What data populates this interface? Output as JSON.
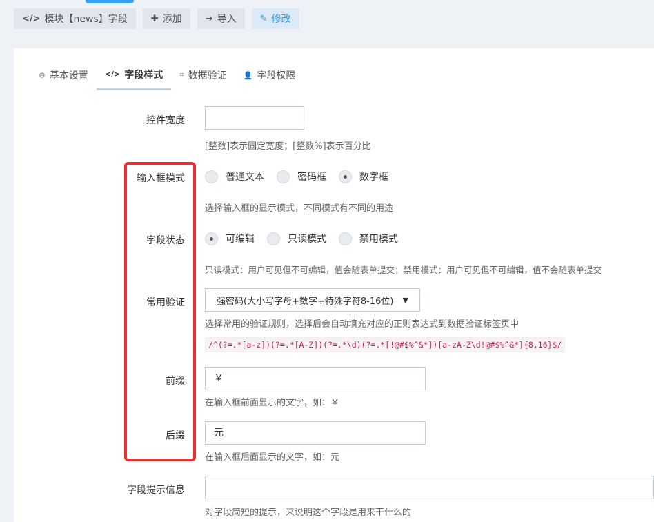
{
  "toolbar": {
    "module_label": "模块【news】字段",
    "add_label": "添加",
    "import_label": "导入",
    "edit_label": "修改"
  },
  "tabs": [
    {
      "label": "基本设置",
      "icon": "gear-icon"
    },
    {
      "label": "字段样式",
      "icon": "code-icon"
    },
    {
      "label": "数据验证",
      "icon": "crop-icon"
    },
    {
      "label": "字段权限",
      "icon": "user-icon"
    }
  ],
  "form": {
    "width": {
      "label": "控件宽度",
      "value": "",
      "help": "[整数]表示固定宽度；[整数%]表示百分比"
    },
    "input_mode": {
      "label": "输入框模式",
      "options": [
        "普通文本",
        "密码框",
        "数字框"
      ],
      "selected": "数字框",
      "help": "选择输入框的显示模式，不同模式有不同的用途"
    },
    "field_state": {
      "label": "字段状态",
      "options": [
        "可编辑",
        "只读模式",
        "禁用模式"
      ],
      "selected": "可编辑",
      "help": "只读模式：用户可见但不可编辑，值会随表单提交；禁用模式：用户可见但不可编辑，值不会随表单提交"
    },
    "common_validation": {
      "label": "常用验证",
      "selected": "强密码(大小写字母+数字+特殊字符8-16位)",
      "help": "选择常用的验证规则，选择后会自动填充对应的正则表达式到数据验证标签页中",
      "regex": "/^(?=.*[a-z])(?=.*[A-Z])(?=.*\\d)(?=.*[!@#$%^&*])[a-zA-Z\\d!@#$%^&*]{8,16}$/"
    },
    "prefix": {
      "label": "前缀",
      "value": "￥",
      "help": "在输入框前面显示的文字，如：￥"
    },
    "suffix": {
      "label": "后缀",
      "value": "元",
      "help": "在输入框后面显示的文字，如：元"
    },
    "tip": {
      "label": "字段提示信息",
      "value": "",
      "help": "对字段简短的提示，来说明这个字段是用来干什么的"
    }
  },
  "colors": {
    "accent": "#3598dc",
    "highlight_box": "#ef2d2d",
    "regex_text": "#c7254e"
  }
}
